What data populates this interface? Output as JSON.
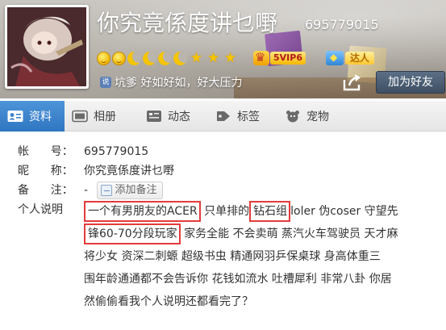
{
  "profile": {
    "nickname": "你究竟係度讲乜嘢",
    "qq_number": "695779015",
    "vip_label": "5VIP6",
    "daren_label": "达人",
    "signature": "坑爹 好如好如，好大压力",
    "signature_icon_text": "说",
    "add_friend_label": "加为好友"
  },
  "level_icons": [
    "face",
    "face",
    "moon",
    "moon",
    "moon",
    "moon",
    "star",
    "star",
    "star"
  ],
  "tabs": [
    {
      "label": "资料",
      "icon": "profile-card-icon",
      "active": true
    },
    {
      "label": "相册",
      "icon": "photo-album-icon",
      "active": false
    },
    {
      "label": "动态",
      "icon": "feed-icon",
      "active": false
    },
    {
      "label": "标签",
      "icon": "tag-icon",
      "active": false
    },
    {
      "label": "宠物",
      "icon": "pet-icon",
      "active": false
    }
  ],
  "info": {
    "account_label": "帐      号：",
    "account_value": "695779015",
    "nickname_label": "昵      称：",
    "nickname_value": "你究竟係度讲乜嘢",
    "remark_label": "备      注：",
    "remark_value": "-",
    "remark_button": "添加备注",
    "desc_label": "个人说明",
    "desc_line1": {
      "hl1": "一个有男朋友的ACER",
      "mid1": " 只单排的",
      "hl2": "钻石组",
      "rest": "loler  伪coser  守望先"
    },
    "desc_line2": {
      "hl3": "锋60-70分段玩家",
      "rest": " 家务全能  不会卖萌  蒸汽火车驾驶员  天才麻"
    },
    "desc_line3": "将少女  资深二刺螈  超级书虫  精通网羽乒保桌球  身高体重三",
    "desc_line4": "围年龄通通都不会告诉你  花钱如流水  吐槽犀利  非常八卦  你居",
    "desc_line5": "然偷偷看我个人说明还都看完了？"
  },
  "colors": {
    "tab_active": "#3a82cc",
    "highlight_border": "#e33b3b",
    "star": "#f5c400"
  }
}
